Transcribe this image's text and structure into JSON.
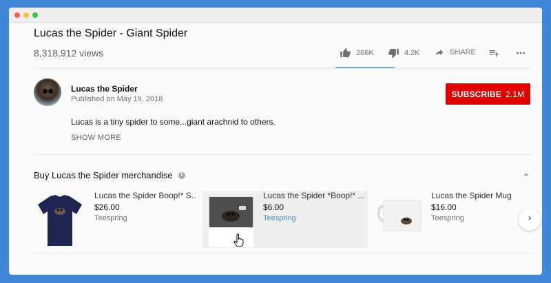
{
  "window": {
    "dot_colors": [
      "#fc605c",
      "#fdbc40",
      "#34c84a"
    ]
  },
  "video": {
    "title": "Lucas the Spider - Giant Spider",
    "views": "8,318,912 views"
  },
  "actions": {
    "likes": "266K",
    "dislikes": "4.2K",
    "share": "SHARE"
  },
  "channel": {
    "name": "Lucas the Spider",
    "published": "Published on May 19, 2018",
    "subscribe_label": "SUBSCRIBE",
    "subscriber_count": "2.1M"
  },
  "description": {
    "text": "Lucas is a tiny spider to some...giant arachnid to others.",
    "show_more": "SHOW MORE"
  },
  "merch": {
    "title": "Buy Lucas the Spider merchandise",
    "items": [
      {
        "name": "Lucas the Spider Boop!* S...",
        "price": "$26.00",
        "store": "Teespring",
        "product": "t-shirt"
      },
      {
        "name": "Lucas the Spider *Boop!* ...",
        "price": "$6.00",
        "store": "Teespring",
        "product": "sticker"
      },
      {
        "name": "Lucas the Spider Mug",
        "price": "$16.00",
        "store": "Teespring",
        "product": "mug"
      }
    ]
  },
  "icons": {
    "like": "thumbs-up-icon",
    "dislike": "thumbs-down-icon",
    "share": "share-arrow-icon",
    "add_to_playlist": "playlist-add-icon",
    "more": "more-horiz-icon",
    "info": "info-icon",
    "collapse": "chevron-up-icon",
    "next": "chevron-right-icon",
    "cursor": "hand-pointer-icon"
  },
  "colors": {
    "subscribe": "#e00000",
    "store_link": "#4a90c8",
    "page_background": "#3f87d9"
  }
}
